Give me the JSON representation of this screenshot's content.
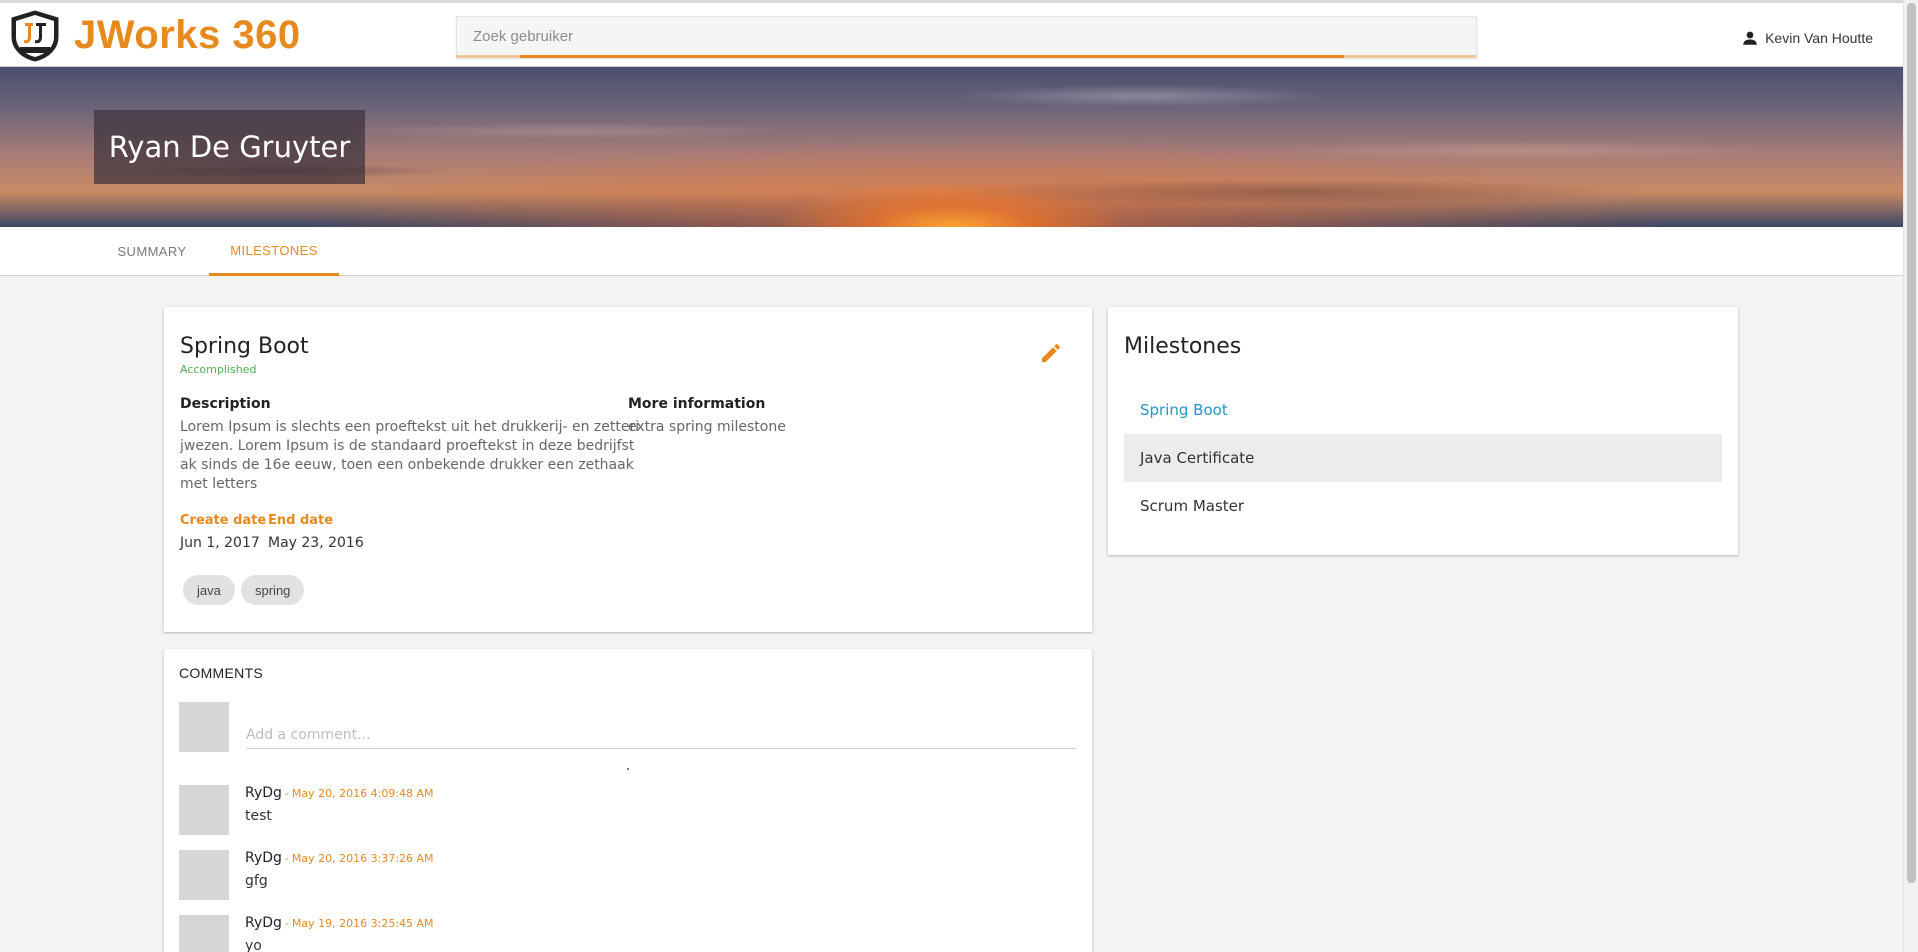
{
  "header": {
    "brand": "JWorks 360",
    "search_placeholder": "Zoek gebruiker",
    "user_name": "Kevin Van Houtte"
  },
  "hero": {
    "name": "Ryan De Gruyter"
  },
  "tabs": [
    {
      "label": "SUMMARY",
      "active": false
    },
    {
      "label": "MILESTONES",
      "active": true
    }
  ],
  "milestone": {
    "title": "Spring Boot",
    "status": "Accomplished",
    "description_label": "Description",
    "description_lines": [
      "Lorem Ipsum is slechts een proeftekst uit het drukkerij- en zetteri",
      "jwezen. Lorem Ipsum is de standaard proeftekst in deze bedrijfst",
      "ak sinds de 16e eeuw, toen een onbekende drukker een zethaak",
      "met letters"
    ],
    "more_info_label": "More information",
    "more_info": "extra spring milestone",
    "create_date_label": "Create date",
    "create_date": "Jun 1, 2017",
    "end_date_label": "End date",
    "end_date": "May 23, 2016",
    "tags": [
      "java",
      "spring"
    ]
  },
  "comments": {
    "title": "COMMENTS",
    "input_placeholder": "Add a comment...",
    "items": [
      {
        "author": "RyDg",
        "time": "May 20, 2016 4:09:48 AM",
        "text": "test"
      },
      {
        "author": "RyDg",
        "time": "May 20, 2016 3:37:26 AM",
        "text": "gfg"
      },
      {
        "author": "RyDg",
        "time": "May 19, 2016 3:25:45 AM",
        "text": "yo"
      }
    ]
  },
  "milestone_list": {
    "title": "Milestones",
    "items": [
      {
        "label": "Spring Boot",
        "state": "active"
      },
      {
        "label": "Java Certificate",
        "state": "hover"
      },
      {
        "label": "Scrum Master",
        "state": "normal"
      }
    ]
  },
  "colors": {
    "accent": "#e8891e",
    "success": "#4caf50",
    "link": "#2196c8"
  }
}
